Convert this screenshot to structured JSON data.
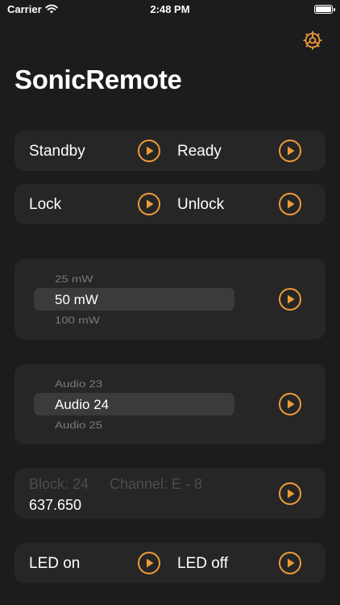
{
  "status": {
    "carrier": "Carrier",
    "time": "2:48 PM"
  },
  "app": {
    "title": "SonicRemote",
    "accent": "#f09a37"
  },
  "controls": {
    "standby": "Standby",
    "ready": "Ready",
    "lock": "Lock",
    "unlock": "Unlock",
    "led_on": "LED on",
    "led_off": "LED off"
  },
  "power_picker": {
    "prev": "25 mW",
    "selected": "50 mW",
    "next": "100 mW"
  },
  "audio_picker": {
    "prev": "Audio 23",
    "selected": "Audio 24",
    "next": "Audio 25"
  },
  "frequency": {
    "block_label": "Block: 24",
    "channel_label": "Channel: E - 8",
    "value": "637.650"
  },
  "icons": {
    "settings": "gear-icon",
    "play": "play-circle-icon",
    "wifi": "wifi-icon",
    "battery": "battery-icon"
  }
}
